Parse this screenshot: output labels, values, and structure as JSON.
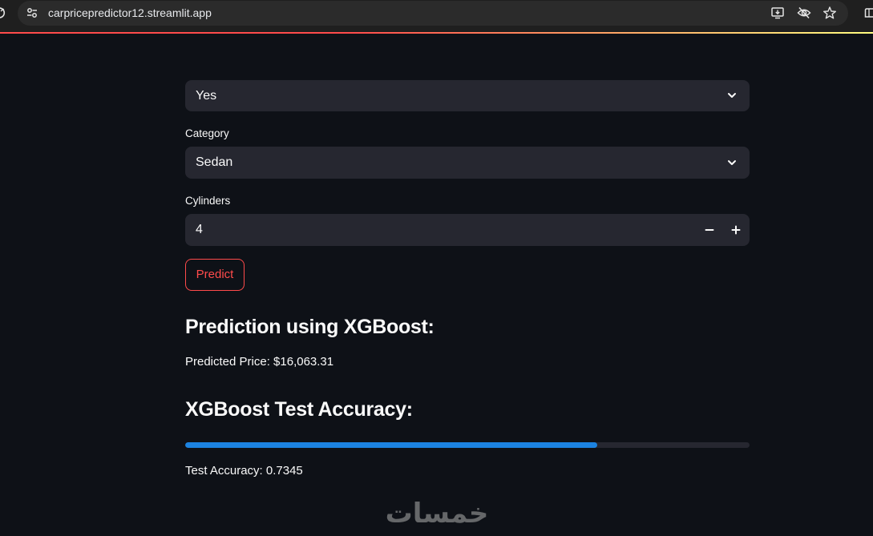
{
  "browser": {
    "url": "carpricepredictor12.streamlit.app",
    "icons": [
      "reload-icon",
      "site-info-icon",
      "install-app-icon",
      "eye-off-icon",
      "star-icon",
      "extensions-icon"
    ]
  },
  "colors": {
    "background": "#0e1117",
    "input": "#262730",
    "accent": "#ff4b4b",
    "progress": "#1c83e1",
    "text": "#fafafa",
    "decoration_start": "#ff4b4b",
    "decoration_end": "#fffd80"
  },
  "form": {
    "top_select": {
      "value": "Yes"
    },
    "category": {
      "label": "Category",
      "value": "Sedan"
    },
    "cylinders": {
      "label": "Cylinders",
      "value": "4"
    },
    "predict_button": {
      "label": "Predict"
    },
    "icons": {
      "dropdown": "chevron-down-icon",
      "decrement": "minus-icon",
      "increment": "plus-icon"
    }
  },
  "prediction": {
    "heading": "Prediction using XGBoost:",
    "result": "Predicted Price: $16,063.31"
  },
  "accuracy": {
    "heading": "XGBoost Test Accuracy:",
    "progress": 0.73,
    "result": "Test Accuracy: 0.7345"
  },
  "watermark": {
    "text": "خمسات"
  }
}
